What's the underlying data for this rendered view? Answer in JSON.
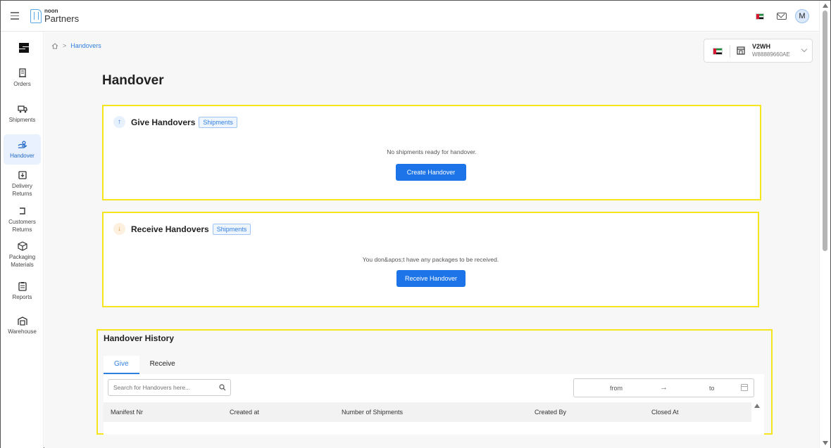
{
  "brand": {
    "top_text": "noon",
    "name": "Partners"
  },
  "header": {
    "avatar_initial": "M"
  },
  "sidebar": {
    "items": [
      {
        "label": "Orders",
        "icon": "receipt-icon"
      },
      {
        "label": "Shipments",
        "icon": "truck-icon"
      },
      {
        "label": "Handover",
        "icon": "handover-icon",
        "active": true
      },
      {
        "label": "Delivery Returns",
        "icon": "return-box-icon"
      },
      {
        "label": "Customers Returns",
        "icon": "customer-return-icon"
      },
      {
        "label": "Packaging Materials",
        "icon": "package-icon"
      },
      {
        "label": "Reports",
        "icon": "clipboard-icon"
      },
      {
        "label": "Warehouse",
        "icon": "warehouse-icon"
      }
    ]
  },
  "breadcrumb": {
    "current": "Handovers"
  },
  "warehouse": {
    "code": "V2WH",
    "id": "W88889660AE"
  },
  "page": {
    "title": "Handover"
  },
  "give": {
    "title": "Give Handovers",
    "badge": "Shipments",
    "message": "No shipments ready for handover.",
    "button": "Create Handover"
  },
  "receive": {
    "title": "Receive Handovers",
    "badge": "Shipments",
    "message": "You don&apos;t have any packages to be received.",
    "button": "Receive Handover"
  },
  "history": {
    "title": "Handover History",
    "tabs": [
      "Give",
      "Receive"
    ],
    "active_tab": "Give",
    "search_placeholder": "Search for Handovers here...",
    "date_from": "from",
    "date_arrow": "→",
    "date_to": "to",
    "columns": [
      "Manifest Nr",
      "Created at",
      "Number of Shipments",
      "Created By",
      "Closed At"
    ]
  },
  "colors": {
    "primary": "#1d74e8",
    "highlight": "#f4e51e",
    "active_bg": "#e8f1fd"
  }
}
